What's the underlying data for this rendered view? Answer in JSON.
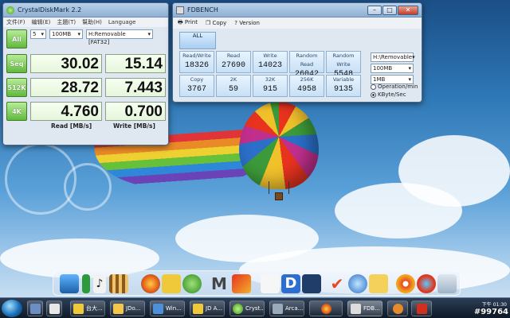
{
  "cdm": {
    "title": "CrystalDiskMark 2.2",
    "menu": [
      "文件(F)",
      "编辑(E)",
      "主題(T)",
      "幫助(H)",
      "Language"
    ],
    "runs": "5",
    "size": "100MB",
    "drive": "H:Removable [FAT32]",
    "buttons": {
      "all": "All",
      "seq": "Seq",
      "k512": "512K",
      "k4": "4K"
    },
    "results": {
      "seq_read": "30.02",
      "seq_write": "15.14",
      "k512_read": "28.72",
      "k512_write": "7.443",
      "k4_read": "4.760",
      "k4_write": "0.700"
    },
    "col_read": "Read [MB/s]",
    "col_write": "Write [MB/s]"
  },
  "fdbench": {
    "title": "FDBENCH",
    "toolbar": {
      "print": "Print",
      "copy": "Copy",
      "version": "Version"
    },
    "all_label": "ALL",
    "row1": [
      {
        "label": "Read/Write",
        "value": "18326"
      },
      {
        "label": "Read",
        "value": "27690"
      },
      {
        "label": "Write",
        "value": "14023"
      },
      {
        "label": "Random Read",
        "value": "26042"
      },
      {
        "label": "Random Write",
        "value": "5548"
      }
    ],
    "row2": [
      {
        "label": "Copy",
        "value": "3767"
      },
      {
        "label": "2K",
        "value": "59"
      },
      {
        "label": "32K",
        "value": "915"
      },
      {
        "label": "256K",
        "value": "4958"
      },
      {
        "label": "Variable",
        "value": "9135"
      }
    ],
    "drive": "H:\\Removable",
    "size": "100MB",
    "block": "1MB",
    "unit_options": [
      "Operation/min",
      "KByte/Sec"
    ],
    "unit_selected": "KByte/Sec"
  },
  "taskbar": {
    "items": [
      "台大...",
      "JDo...",
      "Win...",
      "JD A...",
      "Cryst...",
      "Arca...",
      "",
      "FDB...",
      "",
      ""
    ],
    "clock": "下午 01:30",
    "watermark": "#99764"
  }
}
